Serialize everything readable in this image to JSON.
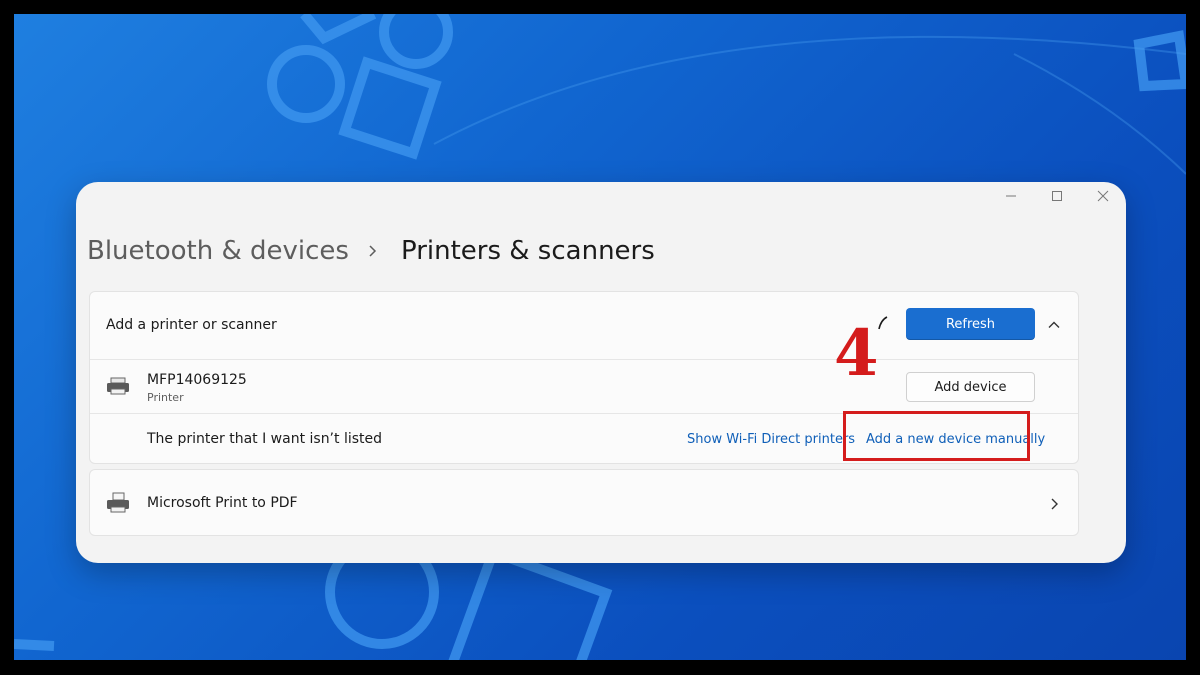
{
  "window": {
    "controls": {
      "minimize": "minimize-icon",
      "maximize": "maximize-icon",
      "close": "close-icon"
    }
  },
  "breadcrumb": {
    "parent": "Bluetooth & devices",
    "current": "Printers & scanners"
  },
  "add_section": {
    "label": "Add a printer or scanner",
    "refresh_label": "Refresh",
    "found_device": {
      "name": "MFP14069125",
      "type": "Printer",
      "button_label": "Add device"
    },
    "not_listed": {
      "label": "The printer that I want isn’t listed",
      "wifi_direct_link": "Show Wi-Fi Direct printers",
      "manual_link": "Add a new device manually"
    }
  },
  "devices": [
    {
      "name": "Microsoft Print to PDF"
    }
  ],
  "annotation": {
    "step": "4",
    "color": "#d41c1c"
  },
  "colors": {
    "accent": "#1a6ed0",
    "link": "#0f5fb8",
    "wallpaper": "#1166d0"
  }
}
